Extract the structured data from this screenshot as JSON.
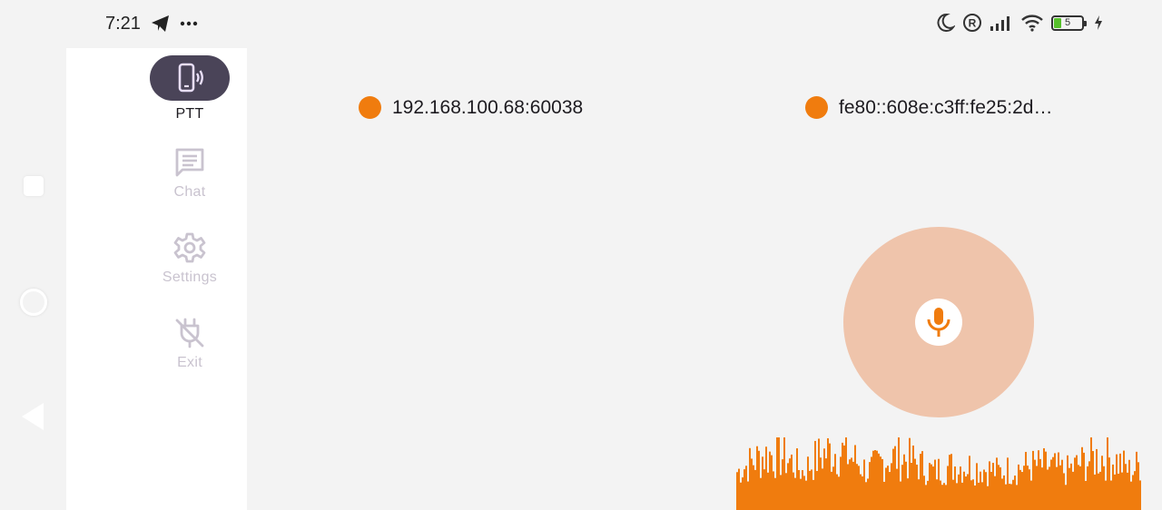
{
  "status_bar": {
    "time": "7:21",
    "left_icons": [
      "telegram-icon",
      "more-dots-icon"
    ],
    "right_icons": [
      "moon-icon",
      "registered-icon",
      "signal-icon",
      "wifi-icon",
      "battery-icon",
      "charging-icon"
    ],
    "battery_level": "5"
  },
  "nav_rail": {
    "items": [
      {
        "label": "PTT",
        "icon": "phone-vibrate-icon",
        "active": true
      },
      {
        "label": "Chat",
        "icon": "chat-icon",
        "active": false
      },
      {
        "label": "Settings",
        "icon": "gear-icon",
        "active": false
      },
      {
        "label": "Exit",
        "icon": "unplug-icon",
        "active": false
      }
    ]
  },
  "peers": [
    {
      "address": "192.168.100.68:60038",
      "status_color": "#f07c0e"
    },
    {
      "address": "fe80::608e:c3ff:fe25:2d…",
      "status_color": "#f07c0e"
    }
  ],
  "ptt": {
    "icon": "microphone-icon",
    "circle_color": "#efc4ab",
    "accent": "#f07c0e"
  }
}
